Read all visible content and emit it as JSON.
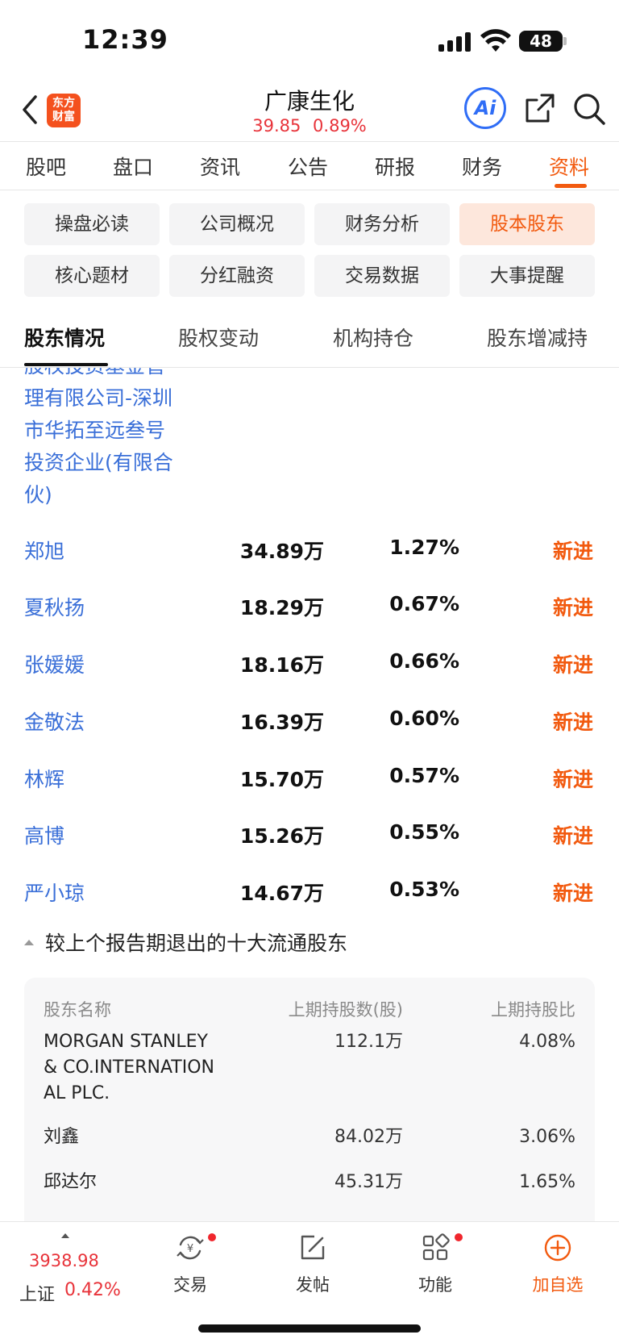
{
  "status_bar": {
    "time": "12:39",
    "battery": "48"
  },
  "header": {
    "logo_text": "东方\n财富",
    "stock_name": "广康生化",
    "price": "39.85",
    "change_pct": "0.89%",
    "ai_label": "Ai"
  },
  "main_tabs": [
    "股吧",
    "盘口",
    "资讯",
    "公告",
    "研报",
    "财务",
    "资料"
  ],
  "sub_buttons": [
    "操盘必读",
    "公司概况",
    "财务分析",
    "股本股东",
    "核心题材",
    "分红融资",
    "交易数据",
    "大事提醒"
  ],
  "holder_tabs": [
    "股东情况",
    "股权变动",
    "机构持仓",
    "股东增减持"
  ],
  "partial_holder_name": "股权投资基金管理有限公司-深圳市华拓至远叁号投资企业(有限合伙)",
  "partial_holder_lines": [
    "股权投资基金管",
    "理有限公司-深圳",
    "市华拓至远叁号",
    "投资企业(有限合",
    "伙)"
  ],
  "holders": [
    {
      "name": "郑旭",
      "shares": "34.89万",
      "ratio": "1.27%",
      "change": "新进"
    },
    {
      "name": "夏秋扬",
      "shares": "18.29万",
      "ratio": "0.67%",
      "change": "新进"
    },
    {
      "name": "张媛媛",
      "shares": "18.16万",
      "ratio": "0.66%",
      "change": "新进"
    },
    {
      "name": "金敬法",
      "shares": "16.39万",
      "ratio": "0.60%",
      "change": "新进"
    },
    {
      "name": "林辉",
      "shares": "15.70万",
      "ratio": "0.57%",
      "change": "新进"
    },
    {
      "name": "高博",
      "shares": "15.26万",
      "ratio": "0.55%",
      "change": "新进"
    },
    {
      "name": "严小琼",
      "shares": "14.67万",
      "ratio": "0.53%",
      "change": "新进"
    }
  ],
  "exited": {
    "title": "较上个报告期退出的十大流通股东",
    "columns": [
      "股东名称",
      "上期持股数(股)",
      "上期持股比"
    ],
    "rows": [
      {
        "name_lines": [
          "MORGAN STANLEY",
          "& CO.INTERNATION",
          "AL PLC."
        ],
        "shares": "112.1万",
        "ratio": "4.08%"
      },
      {
        "name_lines": [
          "刘鑫"
        ],
        "shares": "84.02万",
        "ratio": "3.06%"
      },
      {
        "name_lines": [
          "邱达尔"
        ],
        "shares": "45.31万",
        "ratio": "1.65%"
      }
    ]
  },
  "bottom_bar": {
    "index_value": "3938.98",
    "index_name": "上证",
    "index_change": "0.42%",
    "items": [
      "交易",
      "发帖",
      "功能",
      "加自选"
    ]
  },
  "colors": {
    "accent": "#f25a0f",
    "up_red": "#e8333a",
    "link_blue": "#3a6fd8",
    "ai_blue": "#2f6df6"
  }
}
